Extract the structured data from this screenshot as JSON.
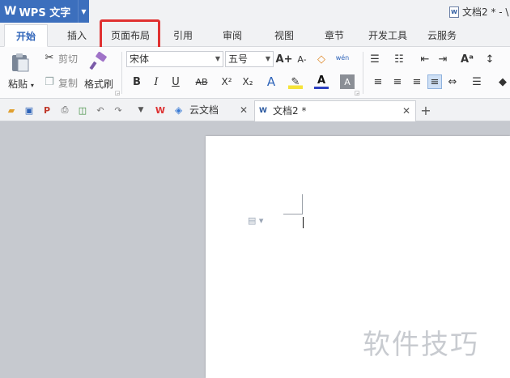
{
  "app": {
    "logo": "W",
    "name": "WPS 文字"
  },
  "window": {
    "doc_title": "文档2 * - \\"
  },
  "ribbon_tabs": [
    {
      "label": "开始",
      "active": true
    },
    {
      "label": "插入"
    },
    {
      "label": "页面布局",
      "highlighted": true
    },
    {
      "label": "引用"
    },
    {
      "label": "审阅"
    },
    {
      "label": "视图"
    },
    {
      "label": "章节"
    },
    {
      "label": "开发工具"
    },
    {
      "label": "云服务"
    }
  ],
  "clipboard": {
    "paste": "粘贴",
    "cut": "剪切",
    "copy": "复制",
    "format_painter": "格式刷"
  },
  "font": {
    "family": "宋体",
    "size": "五号",
    "bold": "B",
    "italic": "I",
    "underline": "U",
    "strike": "AB",
    "superscript": "X²",
    "subscript": "X₂",
    "grow": "A+",
    "shrink": "A-",
    "phonetic": "wén",
    "font_color": "A",
    "char_shading": "A",
    "char_effect": "A"
  },
  "doc_tabs": [
    {
      "label": "云文档"
    },
    {
      "label": "文档2 *",
      "active": true
    }
  ],
  "new_tab": "+",
  "watermark": "软件技巧",
  "colors": {
    "accent": "#3c6fbd",
    "active_tab_text": "#2c62b8",
    "highlight_box": "#e03131",
    "workspace_bg": "#c6c9cf"
  },
  "icons": [
    "paste-icon",
    "cut-icon",
    "copy-icon",
    "format-painter-icon",
    "open-icon",
    "save-icon",
    "pdf-icon",
    "print-icon",
    "preview-icon",
    "undo-icon",
    "redo-icon",
    "wps-icon",
    "cloud-icon"
  ]
}
